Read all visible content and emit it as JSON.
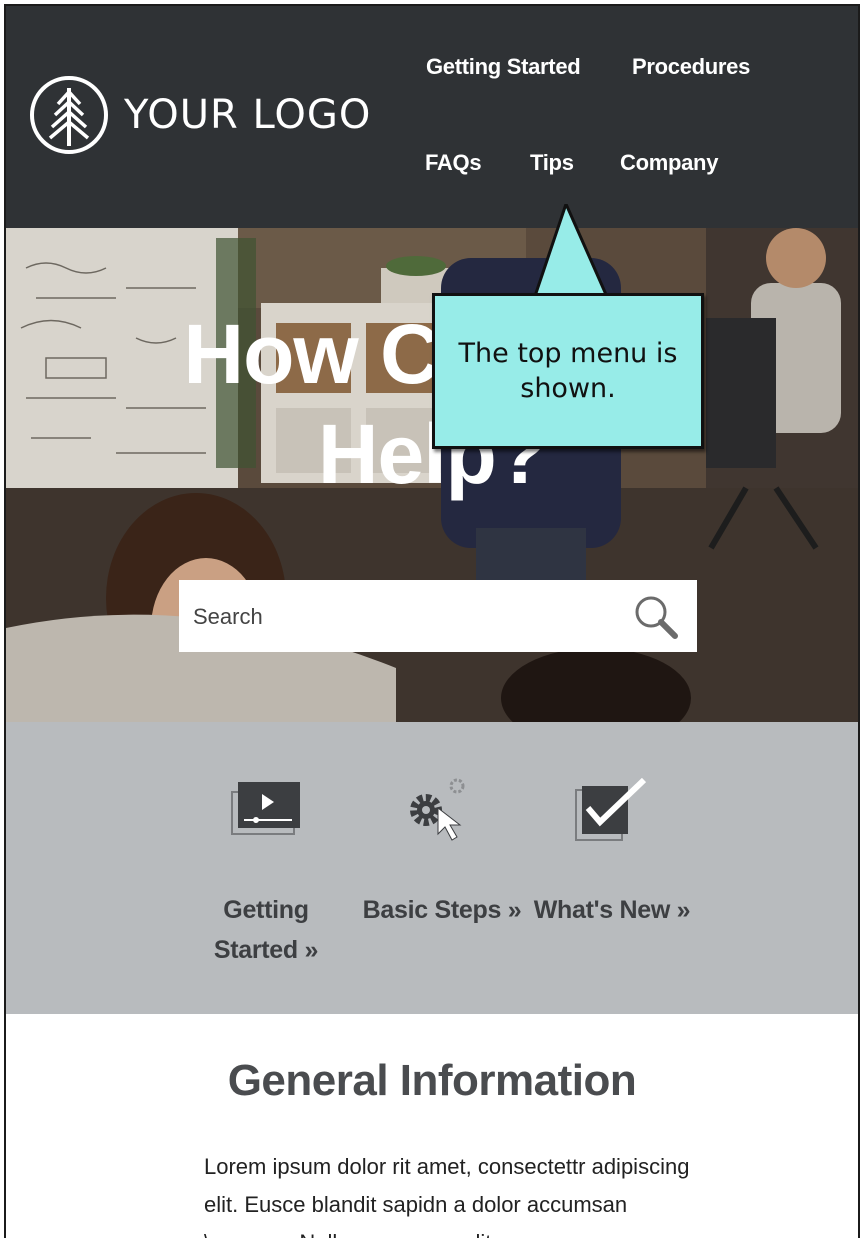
{
  "header": {
    "logo_text": "YOUR LOGO",
    "nav": [
      {
        "label": "Getting Started"
      },
      {
        "label": "Procedures"
      },
      {
        "label": "FAQs"
      },
      {
        "label": "Tips"
      },
      {
        "label": "Company"
      }
    ]
  },
  "hero": {
    "title_line1": "How Can We",
    "title_line2": "Help?",
    "search": {
      "placeholder": "Search",
      "value": ""
    }
  },
  "callout": {
    "text": "The top menu is shown."
  },
  "quick_links": [
    {
      "icon": "video-player-icon",
      "label_line1": "Getting",
      "label_line2": "Started »"
    },
    {
      "icon": "gear-cursor-icon",
      "label_line1": "Basic Steps »",
      "label_line2": ""
    },
    {
      "icon": "checkbox-icon",
      "label_line1": "What's New »",
      "label_line2": ""
    }
  ],
  "general_info": {
    "title": "General Information",
    "body": "Lorem ipsum dolor rit amet, consectettr adipiscing elit. Eusce blandit sapidn a dolor accumsan \\cumsan. Nullam congue velit"
  },
  "colors": {
    "header_bg": "#2f3235",
    "callout_bg": "#97ece8",
    "quick_links_bg": "#b8bbbe",
    "heading_text": "#4a4c4f"
  }
}
